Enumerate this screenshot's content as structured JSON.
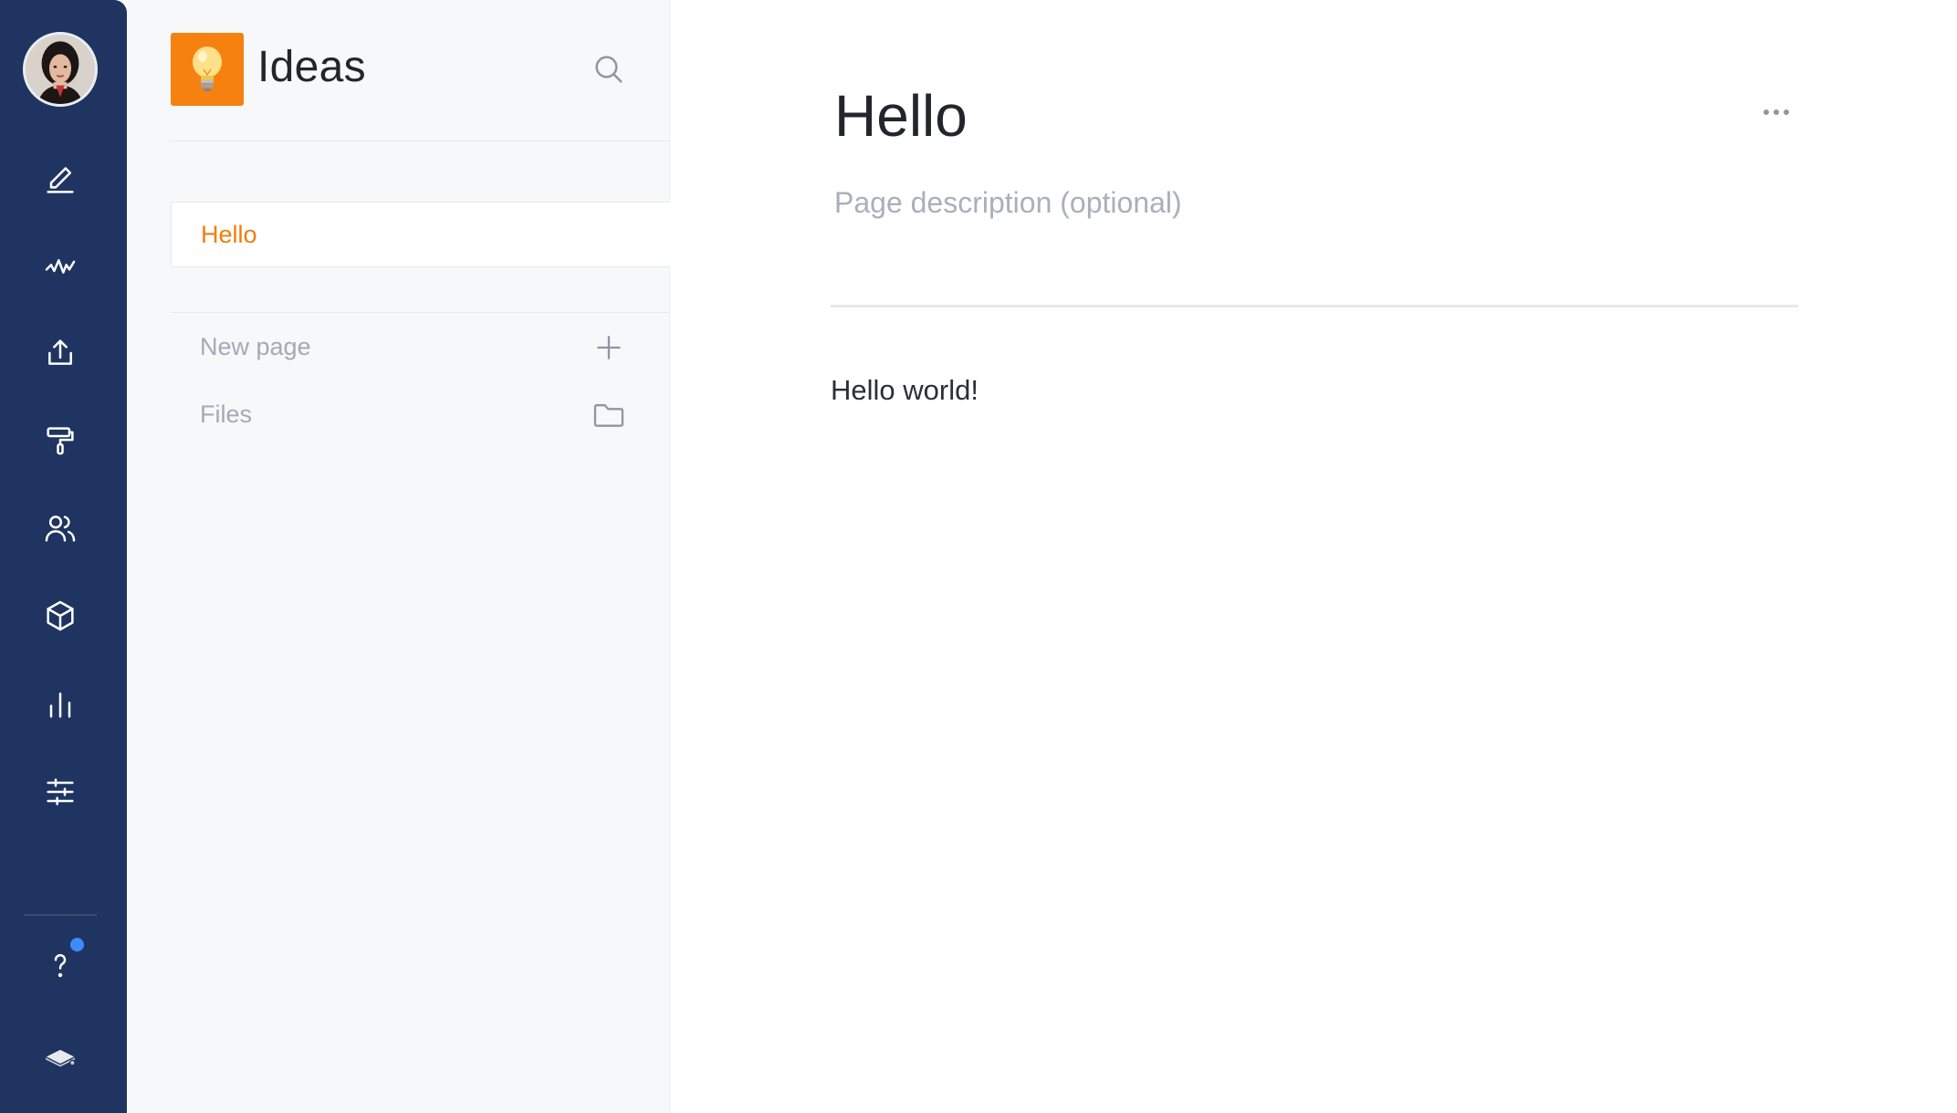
{
  "rail": {
    "items": [
      {
        "icon": "edit-icon"
      },
      {
        "icon": "activity-icon"
      },
      {
        "icon": "upload-icon"
      },
      {
        "icon": "paint-roller-icon"
      },
      {
        "icon": "users-icon"
      },
      {
        "icon": "cube-icon"
      },
      {
        "icon": "bar-chart-icon"
      },
      {
        "icon": "sliders-icon"
      }
    ],
    "help_icon": "help-icon",
    "notification_color": "#3d8bfd",
    "footer_icon": "layers-icon",
    "background": "#1f3460"
  },
  "space": {
    "title": "Ideas",
    "logo_icon": "lightbulb-icon",
    "logo_color": "#f7810f"
  },
  "sidebar": {
    "pages": [
      {
        "label": "Hello",
        "active": true
      }
    ],
    "actions": [
      {
        "label": "New page",
        "icon": "plus-icon"
      },
      {
        "label": "Files",
        "icon": "folder-icon"
      }
    ],
    "accent_color": "#f07d0c"
  },
  "main": {
    "title": "Hello",
    "description_placeholder": "Page description (optional)",
    "body": "Hello world!",
    "more_icon": "more-horizontal-icon"
  }
}
